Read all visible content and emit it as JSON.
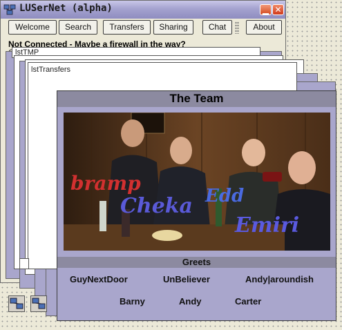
{
  "window": {
    "title": "LUSerNet (alpha)"
  },
  "toolbar": {
    "welcome": "Welcome",
    "search": "Search",
    "transfers": "Transfers",
    "sharing": "Sharing",
    "chat": "Chat",
    "about": "About"
  },
  "status": {
    "text": "Not Connected - Maybe a firewall in the way?",
    "prefix_fragment": "C"
  },
  "lists": {
    "tmp": "lstTMP",
    "transfers": "lstTransfers"
  },
  "team": {
    "title": "The Team",
    "photo_captions": [
      "bramp",
      "Cheka",
      "Edd",
      "Emiri"
    ],
    "greets_title": "Greets",
    "greets_row1": [
      "GuyNextDoor",
      "UnBeliever",
      "Andy|aroundish"
    ],
    "greets_row2": [
      "Barny",
      "Andy",
      "Carter"
    ]
  },
  "colors": {
    "panel": "#a9a6cc",
    "panel_bar": "#8c8aa0",
    "titlebar": "#a4a2cf",
    "close": "#d03a1a"
  }
}
